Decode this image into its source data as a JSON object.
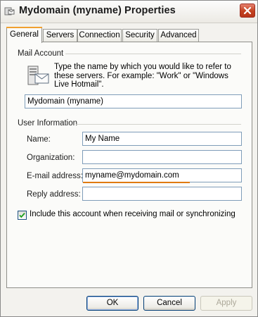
{
  "window": {
    "title": "Mydomain (myname) Properties",
    "icons": {
      "app": "mail-properties-icon",
      "close": "close-icon"
    }
  },
  "tabs": [
    {
      "label": "General",
      "active": true
    },
    {
      "label": "Servers",
      "active": false
    },
    {
      "label": "Connection",
      "active": false
    },
    {
      "label": "Security",
      "active": false
    },
    {
      "label": "Advanced",
      "active": false
    }
  ],
  "mail_account": {
    "heading": "Mail Account",
    "icon": "mail-server-icon",
    "description": "Type the name by which you would like to refer to these servers.  For example: \"Work\" or \"Windows Live Hotmail\".",
    "account_name_value": "Mydomain (myname)"
  },
  "user_information": {
    "heading": "User Information",
    "name_label": "Name:",
    "name_value": "My Name",
    "organization_label": "Organization:",
    "organization_value": "",
    "email_label": "E-mail address:",
    "email_value": "myname@mydomain.com",
    "reply_label": "Reply address:",
    "reply_value": ""
  },
  "include_account": {
    "label": "Include this account when receiving mail or synchronizing",
    "checked": true
  },
  "buttons": {
    "ok": "OK",
    "cancel": "Cancel",
    "apply": "Apply"
  },
  "colors": {
    "tab_highlight": "#f0a030",
    "email_underline": "#e07a10",
    "close_button": "#c2401f",
    "field_border": "#7f9db9"
  }
}
